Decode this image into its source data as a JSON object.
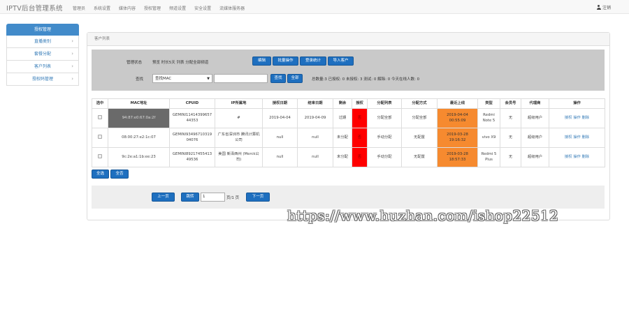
{
  "header": {
    "brand": "IPTV后台管理系统",
    "nav": [
      "管理员",
      "系统设置",
      "媒体内容",
      "授权管理",
      "频道设置",
      "安全设置",
      "流媒体服务器"
    ],
    "logout": "注销"
  },
  "sidebar": {
    "title": "授权管理",
    "items": [
      "直播类别",
      "套餐分配",
      "客户列表",
      "授权码管理"
    ]
  },
  "panel": {
    "title": "客户列表"
  },
  "filter": {
    "status_label": "管理状态",
    "status_text": "预览  时长5天  列表  分配全部频道",
    "buttons": [
      "编辑",
      "批量操作",
      "登录统计",
      "导入客户"
    ],
    "search_label": "查找",
    "select_value": "查找MAC",
    "search_input": "",
    "search_button": "查找",
    "all_button": "全部",
    "stats": "总数量:3  已授权: 0  未授权: 3  测试: 0  解除: 0  今天在线人数: 0"
  },
  "table": {
    "headers": [
      "选中",
      "MAC地址",
      "CPUID",
      "IP所属地",
      "授权日期",
      "结束日期",
      "剩余",
      "授权",
      "分配列表",
      "分配方式",
      "最近上线",
      "类型",
      "会员号",
      "代理商",
      "操作"
    ],
    "rows": [
      {
        "mac": "94:87:e0:67:0a:2f",
        "cpuid": "GEMINI11414399657 44353",
        "ip": "#",
        "start": "2019-04-04",
        "end": "2019-04-09",
        "remain": "过期",
        "auth": "否",
        "list": "分配全部",
        "method": "分配全部",
        "last": "2019-04-04 00:55:09",
        "type": "Redmi Note 5",
        "member": "无",
        "agent": "超级用户",
        "ops": "授权 操作 删除"
      },
      {
        "mac": "08:00:27:e2:1c:07",
        "cpuid": "GEMINI93496710319 04076",
        "ip": "广东省深圳市 腾讯计算机公司",
        "start": "null",
        "end": "null",
        "remain": "未分配",
        "auth": "否",
        "list": "手动分配",
        "method": "无配置",
        "last": "2019-03-28 19:16:32",
        "type": "vivo X9",
        "member": "无",
        "agent": "超级用户",
        "ops": "授权 操作 删除"
      },
      {
        "mac": "9c:2e:a1:1b:ee:23",
        "cpuid": "GEMINI89217455413 49536",
        "ip": "美国 新泽西州 (Merck公司)",
        "start": "null",
        "end": "null",
        "remain": "未分配",
        "auth": "否",
        "list": "手动分配",
        "method": "无配置",
        "last": "2019-03-28 18:57:33",
        "type": "Redmi 5 Plus",
        "member": "无",
        "agent": "超级用户",
        "ops": "授权 操作 删除"
      }
    ]
  },
  "bulk": {
    "select_all": "全选",
    "select_none": "全否"
  },
  "pager": {
    "prev": "上一页",
    "jump": "跳转",
    "page_value": "1",
    "page_of": "页/1 页",
    "next": "下一页"
  },
  "watermark": "https://www.huzhan.com/ishop22512",
  "colors": {
    "primary": "#1e6fbf",
    "sidebar_active": "#428bca",
    "auth_no": "#ff0000",
    "last_online": "#f68a2f"
  }
}
